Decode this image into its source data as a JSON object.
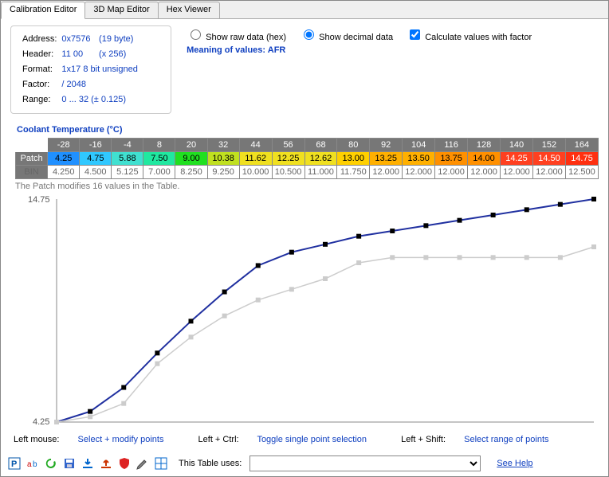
{
  "tabs": [
    "Calibration Editor",
    "3D Map Editor",
    "Hex Viewer"
  ],
  "info": {
    "address_lbl": "Address:",
    "address": "0x7576",
    "address_extra": "(19 byte)",
    "header_lbl": "Header:",
    "header": "11 00",
    "header_extra": "(x 256)",
    "format_lbl": "Format:",
    "format": "1x17   8 bit   unsigned",
    "factor_lbl": "Factor:",
    "factor": "/ 2048",
    "range_lbl": "Range:",
    "range": "0 ... 32  (± 0.125)"
  },
  "opts": {
    "raw": "Show raw data (hex)",
    "dec": "Show decimal data",
    "calc": "Calculate values with factor",
    "meaning_lbl": "Meaning of values:",
    "meaning": "AFR"
  },
  "table_title": "Coolant Temperature (°C)",
  "axis": [
    "-28",
    "-16",
    "-4",
    "8",
    "20",
    "32",
    "44",
    "56",
    "68",
    "80",
    "92",
    "104",
    "116",
    "128",
    "140",
    "152",
    "164"
  ],
  "patch_lbl": "Patch",
  "bin_lbl": "BIN",
  "patch": [
    "4.25",
    "4.75",
    "5.88",
    "7.50",
    "9.00",
    "10.38",
    "11.62",
    "12.25",
    "12.62",
    "13.00",
    "13.25",
    "13.50",
    "13.75",
    "14.00",
    "14.25",
    "14.50",
    "14.75"
  ],
  "patch_colors": [
    "#2090ff",
    "#30c8ff",
    "#40e0d0",
    "#20e8a0",
    "#20e020",
    "#c0e020",
    "#f0e020",
    "#f0e020",
    "#f0e020",
    "#ffd000",
    "#ffb000",
    "#ffb000",
    "#ff9000",
    "#ff9000",
    "#ff4020",
    "#ff4020",
    "#ff3010"
  ],
  "bin": [
    "4.250",
    "4.500",
    "5.125",
    "7.000",
    "8.250",
    "9.250",
    "10.000",
    "10.500",
    "11.000",
    "11.750",
    "12.000",
    "12.000",
    "12.000",
    "12.000",
    "12.000",
    "12.000",
    "12.500"
  ],
  "note": "The Patch modifies 16 values in the Table.",
  "hints": {
    "lmouse_lbl": "Left mouse:",
    "lmouse": "Select + modify points",
    "lctrl_lbl": "Left + Ctrl:",
    "lctrl": "Toggle single point selection",
    "lshift_lbl": "Left + Shift:",
    "lshift": "Select range of points"
  },
  "toolbar": {
    "uses_lbl": "This Table uses:",
    "seehelp": "See Help"
  },
  "chart_data": {
    "type": "line",
    "x": [
      -28,
      -16,
      -4,
      8,
      20,
      32,
      44,
      56,
      68,
      80,
      92,
      104,
      116,
      128,
      140,
      152,
      164
    ],
    "series": [
      {
        "name": "Patch",
        "values": [
          4.25,
          4.75,
          5.88,
          7.5,
          9.0,
          10.38,
          11.62,
          12.25,
          12.62,
          13.0,
          13.25,
          13.5,
          13.75,
          14.0,
          14.25,
          14.5,
          14.75
        ]
      },
      {
        "name": "BIN",
        "values": [
          4.25,
          4.5,
          5.125,
          7.0,
          8.25,
          9.25,
          10.0,
          10.5,
          11.0,
          11.75,
          12.0,
          12.0,
          12.0,
          12.0,
          12.0,
          12.0,
          12.5
        ]
      }
    ],
    "ylim": [
      4.25,
      14.75
    ],
    "ylabel_top": "14.75",
    "ylabel_bot": "4.25"
  }
}
